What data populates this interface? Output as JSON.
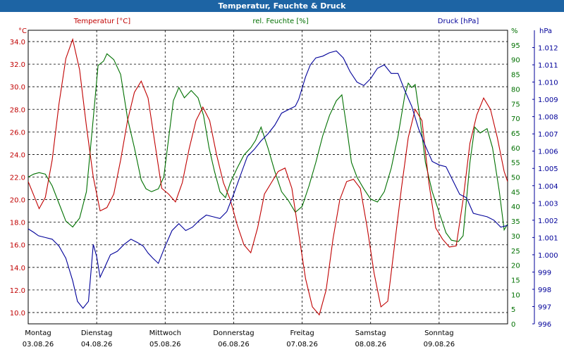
{
  "window_title": "Temperatur, Feuchte & Druck",
  "chart_data": {
    "type": "line",
    "title": "Temperatur, Feuchte & Druck",
    "grid": true,
    "x_days": [
      {
        "day": "Montag",
        "date": "03.08.26"
      },
      {
        "day": "Dienstag",
        "date": "04.08.26"
      },
      {
        "day": "Mittwoch",
        "date": "05.08.26"
      },
      {
        "day": "Donnerstag",
        "date": "06.08.26"
      },
      {
        "day": "Freitag",
        "date": "07.08.26"
      },
      {
        "day": "Samstag",
        "date": "08.08.26"
      },
      {
        "day": "Sonntag",
        "date": "09.08.26"
      }
    ],
    "x_range_days": [
      0,
      7
    ],
    "axes": {
      "temperature": {
        "label": "Temperatur [°C]",
        "unit": "°C",
        "color": "#c00000",
        "min": 9.0,
        "max": 35.0,
        "ticks": [
          "10.0",
          "12.0",
          "14.0",
          "16.0",
          "18.0",
          "20.0",
          "22.0",
          "24.0",
          "26.0",
          "28.0",
          "30.0",
          "32.0",
          "34.0"
        ]
      },
      "humidity": {
        "label": "rel. Feuchte [%]",
        "unit": "%",
        "color": "#007000",
        "min": 0,
        "max": 100,
        "ticks": [
          "0",
          "5",
          "10",
          "15",
          "20",
          "25",
          "30",
          "35",
          "40",
          "45",
          "50",
          "55",
          "60",
          "65",
          "70",
          "75",
          "80",
          "85",
          "90",
          "95"
        ]
      },
      "pressure": {
        "label": "Druck [hPa]",
        "unit": "hPa",
        "color": "#000099",
        "min": 996,
        "max": 1013,
        "ticks": [
          "996",
          "997",
          "998",
          "999",
          "1.000",
          "1.001",
          "1.002",
          "1.003",
          "1.004",
          "1.005",
          "1.006",
          "1.007",
          "1.008",
          "1.009",
          "1.010",
          "1.011",
          "1.012"
        ]
      }
    },
    "series": [
      {
        "name": "Temperatur [°C]",
        "axis": "temperature",
        "color": "#c00000",
        "points": [
          [
            0.0,
            21.6
          ],
          [
            0.08,
            20.4
          ],
          [
            0.16,
            19.2
          ],
          [
            0.25,
            20.2
          ],
          [
            0.35,
            23.5
          ],
          [
            0.45,
            28.5
          ],
          [
            0.55,
            32.5
          ],
          [
            0.65,
            34.2
          ],
          [
            0.75,
            31.5
          ],
          [
            0.85,
            26.5
          ],
          [
            0.95,
            22.0
          ],
          [
            1.05,
            19.0
          ],
          [
            1.15,
            19.3
          ],
          [
            1.25,
            20.5
          ],
          [
            1.35,
            23.5
          ],
          [
            1.45,
            27.0
          ],
          [
            1.55,
            29.5
          ],
          [
            1.65,
            30.5
          ],
          [
            1.75,
            29.0
          ],
          [
            1.85,
            25.0
          ],
          [
            1.95,
            21.0
          ],
          [
            2.05,
            20.5
          ],
          [
            2.15,
            19.8
          ],
          [
            2.25,
            21.5
          ],
          [
            2.35,
            24.5
          ],
          [
            2.45,
            27.0
          ],
          [
            2.55,
            28.2
          ],
          [
            2.65,
            27.0
          ],
          [
            2.75,
            24.0
          ],
          [
            2.85,
            21.5
          ],
          [
            2.95,
            20.0
          ],
          [
            3.05,
            17.8
          ],
          [
            3.15,
            16.0
          ],
          [
            3.25,
            15.3
          ],
          [
            3.35,
            17.5
          ],
          [
            3.45,
            20.5
          ],
          [
            3.55,
            21.5
          ],
          [
            3.65,
            22.5
          ],
          [
            3.75,
            22.8
          ],
          [
            3.85,
            21.0
          ],
          [
            3.95,
            17.0
          ],
          [
            4.05,
            13.0
          ],
          [
            4.15,
            10.5
          ],
          [
            4.25,
            9.8
          ],
          [
            4.35,
            12.0
          ],
          [
            4.45,
            16.5
          ],
          [
            4.55,
            20.0
          ],
          [
            4.65,
            21.6
          ],
          [
            4.75,
            21.8
          ],
          [
            4.85,
            21.0
          ],
          [
            4.95,
            17.5
          ],
          [
            5.05,
            13.5
          ],
          [
            5.15,
            10.5
          ],
          [
            5.25,
            11.0
          ],
          [
            5.35,
            16.0
          ],
          [
            5.45,
            21.0
          ],
          [
            5.55,
            25.5
          ],
          [
            5.65,
            28.0
          ],
          [
            5.75,
            27.0
          ],
          [
            5.85,
            21.5
          ],
          [
            5.95,
            17.5
          ],
          [
            6.05,
            16.5
          ],
          [
            6.15,
            15.8
          ],
          [
            6.25,
            15.9
          ],
          [
            6.35,
            20.0
          ],
          [
            6.45,
            25.0
          ],
          [
            6.55,
            27.5
          ],
          [
            6.65,
            29.0
          ],
          [
            6.75,
            28.0
          ],
          [
            6.85,
            25.5
          ],
          [
            6.95,
            22.5
          ],
          [
            7.0,
            21.6
          ]
        ]
      },
      {
        "name": "rel. Feuchte [%]",
        "axis": "humidity",
        "color": "#007000",
        "points": [
          [
            0.0,
            50.0
          ],
          [
            0.08,
            51.0
          ],
          [
            0.16,
            51.5
          ],
          [
            0.25,
            51.0
          ],
          [
            0.35,
            47.0
          ],
          [
            0.45,
            41.0
          ],
          [
            0.55,
            35.0
          ],
          [
            0.65,
            33.0
          ],
          [
            0.75,
            36.0
          ],
          [
            0.85,
            45.0
          ],
          [
            0.95,
            70.0
          ],
          [
            1.02,
            88.0
          ],
          [
            1.1,
            89.5
          ],
          [
            1.15,
            92.0
          ],
          [
            1.25,
            90.0
          ],
          [
            1.35,
            85.0
          ],
          [
            1.45,
            70.0
          ],
          [
            1.55,
            60.0
          ],
          [
            1.65,
            49.0
          ],
          [
            1.72,
            46.0
          ],
          [
            1.8,
            45.0
          ],
          [
            1.9,
            46.0
          ],
          [
            1.98,
            50.0
          ],
          [
            2.05,
            63.0
          ],
          [
            2.12,
            76.0
          ],
          [
            2.2,
            80.5
          ],
          [
            2.28,
            77.0
          ],
          [
            2.38,
            79.5
          ],
          [
            2.48,
            77.0
          ],
          [
            2.56,
            71.0
          ],
          [
            2.64,
            60.0
          ],
          [
            2.72,
            52.0
          ],
          [
            2.8,
            45.0
          ],
          [
            2.88,
            43.0
          ],
          [
            2.95,
            48.0
          ],
          [
            3.05,
            53.0
          ],
          [
            3.15,
            57.5
          ],
          [
            3.25,
            60.0
          ],
          [
            3.32,
            62.5
          ],
          [
            3.4,
            67.0
          ],
          [
            3.5,
            60.0
          ],
          [
            3.6,
            52.0
          ],
          [
            3.7,
            45.0
          ],
          [
            3.8,
            42.0
          ],
          [
            3.9,
            38.0
          ],
          [
            4.0,
            40.0
          ],
          [
            4.1,
            47.0
          ],
          [
            4.2,
            55.0
          ],
          [
            4.3,
            64.0
          ],
          [
            4.4,
            71.0
          ],
          [
            4.5,
            76.0
          ],
          [
            4.58,
            78.0
          ],
          [
            4.65,
            67.0
          ],
          [
            4.72,
            55.0
          ],
          [
            4.8,
            50.0
          ],
          [
            4.9,
            46.0
          ],
          [
            5.0,
            42.5
          ],
          [
            5.1,
            41.5
          ],
          [
            5.2,
            45.0
          ],
          [
            5.3,
            53.0
          ],
          [
            5.4,
            64.0
          ],
          [
            5.5,
            78.0
          ],
          [
            5.55,
            82.0
          ],
          [
            5.6,
            80.5
          ],
          [
            5.65,
            81.5
          ],
          [
            5.72,
            70.0
          ],
          [
            5.8,
            55.0
          ],
          [
            5.9,
            45.0
          ],
          [
            6.0,
            38.0
          ],
          [
            6.1,
            31.0
          ],
          [
            6.18,
            28.5
          ],
          [
            6.28,
            28.0
          ],
          [
            6.35,
            30.0
          ],
          [
            6.45,
            55.0
          ],
          [
            6.52,
            67.0
          ],
          [
            6.6,
            65.0
          ],
          [
            6.7,
            66.5
          ],
          [
            6.78,
            60.0
          ],
          [
            6.88,
            45.0
          ],
          [
            6.95,
            32.0
          ],
          [
            7.0,
            34.0
          ],
          [
            7.1,
            40.0
          ],
          [
            7.2,
            44.5
          ]
        ]
      },
      {
        "name": "Druck [hPa]",
        "axis": "pressure",
        "color": "#000099",
        "points": [
          [
            0.0,
            1001.5
          ],
          [
            0.08,
            1001.3
          ],
          [
            0.15,
            1001.1
          ],
          [
            0.25,
            1001.0
          ],
          [
            0.35,
            1000.9
          ],
          [
            0.45,
            1000.5
          ],
          [
            0.55,
            999.8
          ],
          [
            0.65,
            998.5
          ],
          [
            0.72,
            997.3
          ],
          [
            0.8,
            996.9
          ],
          [
            0.88,
            997.3
          ],
          [
            0.95,
            1000.6
          ],
          [
            1.0,
            999.9
          ],
          [
            1.05,
            998.7
          ],
          [
            1.12,
            999.3
          ],
          [
            1.2,
            1000.0
          ],
          [
            1.3,
            1000.2
          ],
          [
            1.4,
            1000.6
          ],
          [
            1.5,
            1000.9
          ],
          [
            1.6,
            1000.7
          ],
          [
            1.68,
            1000.5
          ],
          [
            1.75,
            1000.1
          ],
          [
            1.82,
            999.8
          ],
          [
            1.9,
            999.5
          ],
          [
            2.0,
            1000.5
          ],
          [
            2.1,
            1001.4
          ],
          [
            2.2,
            1001.8
          ],
          [
            2.3,
            1001.4
          ],
          [
            2.4,
            1001.6
          ],
          [
            2.5,
            1002.0
          ],
          [
            2.6,
            1002.3
          ],
          [
            2.7,
            1002.2
          ],
          [
            2.8,
            1002.1
          ],
          [
            2.9,
            1002.5
          ],
          [
            3.0,
            1003.5
          ],
          [
            3.1,
            1004.6
          ],
          [
            3.2,
            1005.7
          ],
          [
            3.3,
            1006.1
          ],
          [
            3.4,
            1006.6
          ],
          [
            3.5,
            1007.0
          ],
          [
            3.6,
            1007.5
          ],
          [
            3.7,
            1008.2
          ],
          [
            3.8,
            1008.4
          ],
          [
            3.9,
            1008.6
          ],
          [
            3.95,
            1009.0
          ],
          [
            4.05,
            1010.3
          ],
          [
            4.12,
            1011.0
          ],
          [
            4.2,
            1011.4
          ],
          [
            4.3,
            1011.5
          ],
          [
            4.4,
            1011.7
          ],
          [
            4.5,
            1011.8
          ],
          [
            4.6,
            1011.4
          ],
          [
            4.7,
            1010.6
          ],
          [
            4.8,
            1010.0
          ],
          [
            4.9,
            1009.8
          ],
          [
            5.0,
            1010.2
          ],
          [
            5.1,
            1010.8
          ],
          [
            5.2,
            1011.0
          ],
          [
            5.3,
            1010.5
          ],
          [
            5.4,
            1010.5
          ],
          [
            5.5,
            1009.5
          ],
          [
            5.6,
            1008.6
          ],
          [
            5.7,
            1007.3
          ],
          [
            5.8,
            1006.3
          ],
          [
            5.9,
            1005.4
          ],
          [
            6.0,
            1005.2
          ],
          [
            6.1,
            1005.1
          ],
          [
            6.2,
            1004.3
          ],
          [
            6.3,
            1003.5
          ],
          [
            6.4,
            1003.3
          ],
          [
            6.5,
            1002.4
          ],
          [
            6.6,
            1002.3
          ],
          [
            6.7,
            1002.2
          ],
          [
            6.8,
            1002.0
          ],
          [
            6.9,
            1001.6
          ],
          [
            7.0,
            1001.7
          ],
          [
            7.1,
            1002.4
          ],
          [
            7.2,
            1002.2
          ]
        ]
      }
    ]
  }
}
